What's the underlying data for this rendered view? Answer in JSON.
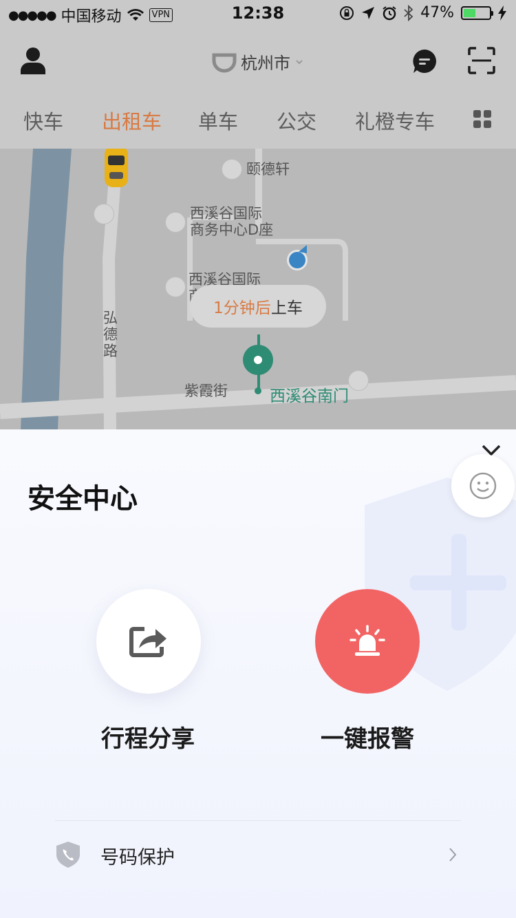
{
  "status_bar": {
    "signal": "●●●●●",
    "carrier": "中国移动",
    "vpn": "VPN",
    "time": "12:38",
    "battery": "47%",
    "battery_level": 0.47
  },
  "header": {
    "city": "杭州市"
  },
  "tabs": [
    {
      "label": "快车",
      "active": false
    },
    {
      "label": "出租车",
      "active": true
    },
    {
      "label": "单车",
      "active": false
    },
    {
      "label": "公交",
      "active": false
    },
    {
      "label": "礼橙专车",
      "active": false
    }
  ],
  "map": {
    "labels": {
      "poi_1": "颐德轩",
      "poi_2_line1": "西溪谷国际",
      "poi_2_line2": "商务中心D座",
      "poi_3_line1": "西溪谷国际",
      "poi_3_line2": "商",
      "road_1": "弘\n德\n路",
      "road_2": "紫霞街"
    },
    "eta_time": "1分钟后",
    "eta_action": "上车",
    "pickup_station": "西溪谷南门"
  },
  "safety_panel": {
    "title": "安全中心",
    "actions": [
      {
        "label": "行程分享",
        "icon": "share-icon"
      },
      {
        "label": "一键报警",
        "icon": "alarm-icon"
      }
    ],
    "number_protection": "号码保护"
  },
  "colors": {
    "accent_orange": "#d87a43",
    "alarm_red": "#f26464",
    "station_green": "#2e8b74"
  }
}
